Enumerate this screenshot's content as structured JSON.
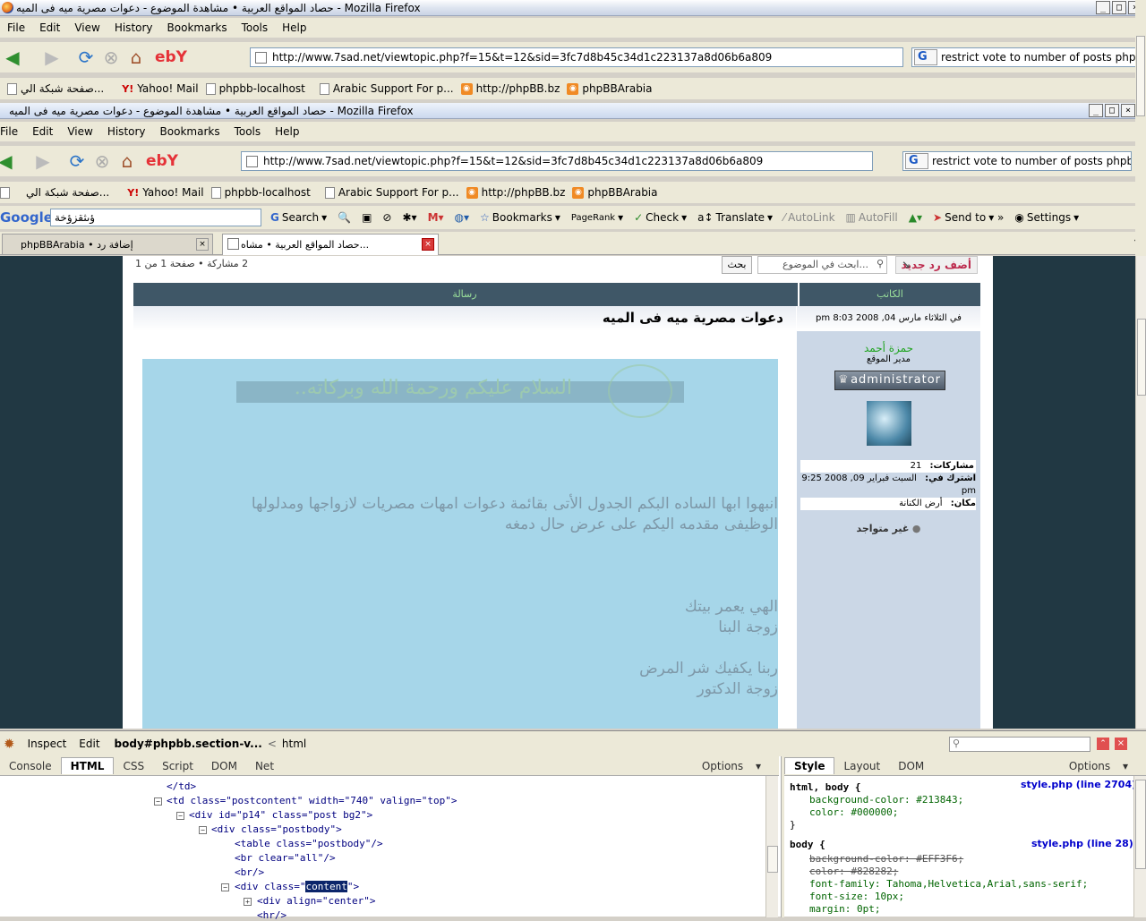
{
  "outer_window": {
    "title": "حصاد المواقع العربية • مشاهدة الموضوع - دعوات مصرية ميه فى الميه - Mozilla Firefox",
    "menu": [
      "File",
      "Edit",
      "View",
      "History",
      "Bookmarks",
      "Tools",
      "Help"
    ],
    "url": "http://www.7sad.net/viewtopic.php?f=15&t=12&sid=3fc7d8b45c34d1c223137a8d06b6a809",
    "search_value": "restrict vote to number of posts phpbb",
    "bookmarks": [
      {
        "label": "صفحة شبكة الي...",
        "icon": "page"
      },
      {
        "label": "Yahoo! Mail",
        "icon": "yahoo"
      },
      {
        "label": "phpbb-localhost",
        "icon": "page"
      },
      {
        "label": "Arabic Support For p...",
        "icon": "page"
      },
      {
        "label": "http://phpBB.bz",
        "icon": "rss"
      },
      {
        "label": "phpBBArabia",
        "icon": "rss"
      }
    ]
  },
  "inner_window": {
    "title": "حصاد المواقع العربية • مشاهدة الموضوع - دعوات مصرية ميه فى الميه - Mozilla Firefox",
    "menu": [
      "File",
      "Edit",
      "View",
      "History",
      "Bookmarks",
      "Tools",
      "Help"
    ],
    "url": "http://www.7sad.net/viewtopic.php?f=15&t=12&sid=3fc7d8b45c34d1c223137a8d06b6a809",
    "search_value": "restrict vote to number of posts phpbb",
    "bookmarks": [
      {
        "label": "صفحة شبكة الي...",
        "icon": "page"
      },
      {
        "label": "Yahoo! Mail",
        "icon": "yahoo"
      },
      {
        "label": "phpbb-localhost",
        "icon": "page"
      },
      {
        "label": "Arabic Support For p...",
        "icon": "page"
      },
      {
        "label": "http://phpBB.bz",
        "icon": "rss"
      },
      {
        "label": "phpBBArabia",
        "icon": "rss"
      }
    ]
  },
  "google_toolbar": {
    "logo": "Google",
    "query": "ؤىثقزؤخة",
    "items": [
      "Search",
      "Bookmarks",
      "PageRank",
      "Check",
      "Translate",
      "AutoLink",
      "AutoFill",
      "Send to",
      "Settings"
    ]
  },
  "tabs": [
    {
      "label": "phpBBArabia • إضافة رد",
      "active": false
    },
    {
      "label": "حصاد المواقع العربية • مشاه...",
      "active": true
    }
  ],
  "forum": {
    "new_reply": "أضف رد جديد",
    "search_placeholder": "ابحث في الموضوع...",
    "search_button": "بحث",
    "pagination": "2 مشاركة • صفحة 1 من 1",
    "col_author": "الكاتب",
    "col_message": "رسالة",
    "post_title": "دعوات مصرية ميه فى الميه",
    "post_date": "في الثلاثاء مارس 04, 2008 8:03 pm",
    "author_name": "حمزة أحمد",
    "author_rank": "مدير الموقع",
    "rank_badge": "administrator",
    "posts_label": "مشاركات:",
    "posts_value": "21",
    "joined_label": "اشترك في:",
    "joined_value": "السبت فبراير 09, 2008 9:25 pm",
    "location_label": "مكان:",
    "location_value": "أرض الكنانة",
    "status": "غير متواجد",
    "greeting": "السلام عليكم ورحمة الله وبركاته..",
    "body_line1": "انبهوا ابها الساده البكم الجدول الأتى بقائمة دعوات امهات مصريات لازواجها ومدلولها",
    "body_line2": "الوظيفى مقدمه اليكم على عرض حال دمغه",
    "body_line3": "الهي يعمر بيتك",
    "body_line4": "زوجة البنا",
    "body_line5": "ربنا يكفيك شر المرض",
    "body_line6": "زوجة الدكتور"
  },
  "firebug": {
    "tools": [
      "Inspect",
      "Edit"
    ],
    "breadcrumb": "body#phpbb.section-v...",
    "breadcrumb2": "html",
    "tabs": [
      "Console",
      "HTML",
      "CSS",
      "Script",
      "DOM",
      "Net"
    ],
    "active_tab": "HTML",
    "options": "Options",
    "side_tabs": [
      "Style",
      "Layout",
      "DOM"
    ],
    "side_active": "Style",
    "html_lines": [
      "</td>",
      "<td class=\"postcontent\" width=\"740\" valign=\"top\">",
      "<div id=\"p14\" class=\"post bg2\">",
      "<div class=\"postbody\">",
      "<table class=\"postbody\"/>",
      "<br clear=\"all\"/>",
      "<br/>",
      "<div class=\"",
      "content",
      "\">",
      "<div align=\"center\">",
      "<hr/>"
    ],
    "css_rules": [
      {
        "selector": "html, body {",
        "source": "style.php (line 2704)"
      },
      {
        "selector": "body {",
        "source": "style.php (line 28)"
      }
    ],
    "css_lines": [
      "background-color: #213843;",
      "color: #000000;",
      "}",
      "background-color: #EFF3F6;",
      "color: #828282;",
      "font-family: Tahoma,Helvetica,Arial,sans-serif;",
      "font-size: 10px;",
      "margin: 0pt;"
    ]
  }
}
